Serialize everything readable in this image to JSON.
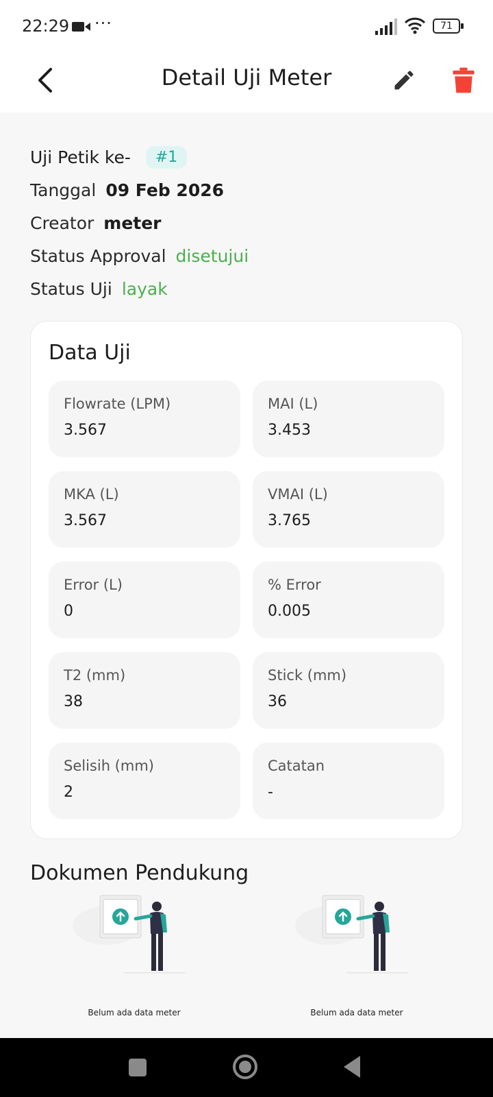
{
  "status_bar": {
    "time": "22:29",
    "dots": "···",
    "battery": "71"
  },
  "app_bar": {
    "title": "Detail Uji Meter"
  },
  "info": {
    "uji_petik_label": "Uji Petik ke-",
    "uji_petik_badge": "#1",
    "tanggal_label": "Tanggal",
    "tanggal_value": "09 Feb 2026",
    "creator_label": "Creator",
    "creator_value": "meter",
    "status_approval_label": "Status Approval",
    "status_approval_value": "disetujui",
    "status_uji_label": "Status Uji",
    "status_uji_value": "layak"
  },
  "data_uji": {
    "title": "Data Uji",
    "fields": [
      {
        "label": "Flowrate (LPM)",
        "value": "3.567"
      },
      {
        "label": "MAI (L)",
        "value": "3.453"
      },
      {
        "label": "MKA (L)",
        "value": "3.567"
      },
      {
        "label": "VMAI (L)",
        "value": "3.765"
      },
      {
        "label": "Error (L)",
        "value": "0"
      },
      {
        "label": "% Error",
        "value": "0.005"
      },
      {
        "label": "T2 (mm)",
        "value": "38"
      },
      {
        "label": "Stick (mm)",
        "value": "36"
      },
      {
        "label": "Selisih (mm)",
        "value": "2"
      },
      {
        "label": "Catatan",
        "value": "-"
      }
    ]
  },
  "dokumen": {
    "title": "Dokumen Pendukung",
    "items": [
      {
        "caption": "Belum ada data meter"
      },
      {
        "caption": "Belum ada data meter"
      }
    ]
  },
  "colors": {
    "accent_green": "#4caf50",
    "badge_teal": "#1fa79a",
    "delete_red": "#f44336",
    "illustration_teal": "#26a69a"
  }
}
